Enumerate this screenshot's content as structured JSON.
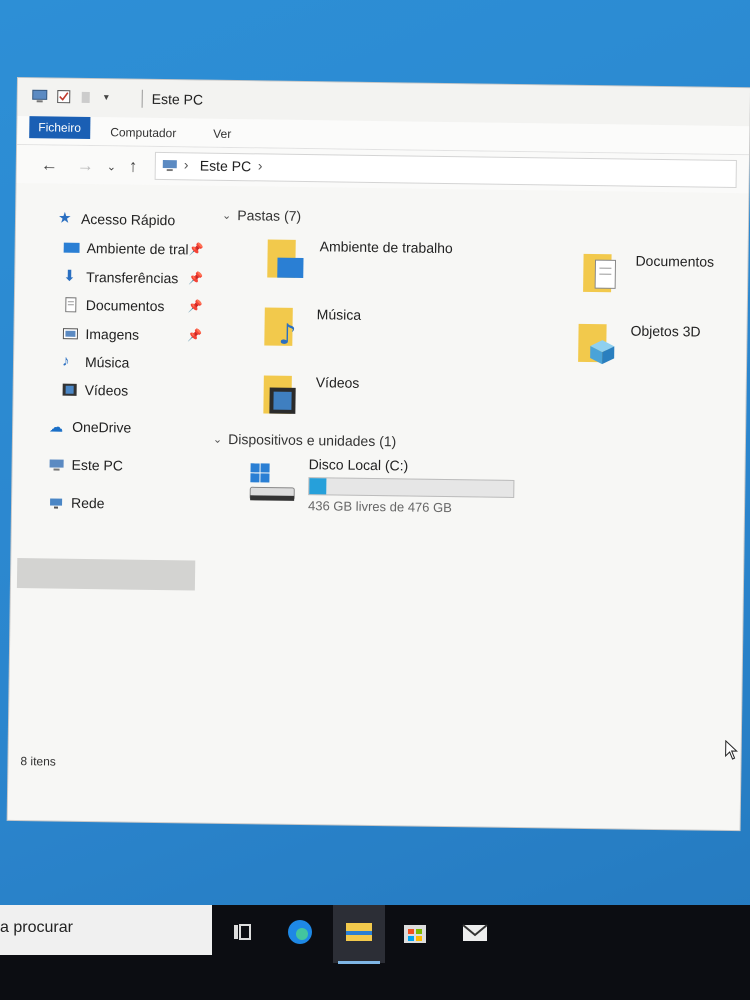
{
  "window": {
    "title": "Este PC",
    "ribbon_tabs": [
      "Ficheiro",
      "Computador",
      "Ver"
    ],
    "address": {
      "crumb": "Este PC"
    },
    "status": "8 itens"
  },
  "navigation": {
    "quick_access": "Acesso Rápido",
    "quick_items": [
      {
        "label": "Ambiente de tral",
        "icon": "desktop-icon",
        "pinned": true
      },
      {
        "label": "Transferências",
        "icon": "download-icon",
        "pinned": true
      },
      {
        "label": "Documentos",
        "icon": "document-icon",
        "pinned": true
      },
      {
        "label": "Imagens",
        "icon": "image-icon",
        "pinned": true
      },
      {
        "label": "Música",
        "icon": "music-icon",
        "pinned": false
      },
      {
        "label": "Vídeos",
        "icon": "video-icon",
        "pinned": false
      }
    ],
    "onedrive": "OneDrive",
    "this_pc": "Este PC",
    "network": "Rede"
  },
  "content": {
    "folders_header": "Pastas (7)",
    "folders": [
      {
        "label": "Ambiente de trabalho",
        "icon": "desktop-folder-icon"
      },
      {
        "label": "Documentos",
        "icon": "documents-folder-icon"
      },
      {
        "label": "Música",
        "icon": "music-folder-icon"
      },
      {
        "label": "Objetos 3D",
        "icon": "3d-objects-folder-icon"
      },
      {
        "label": "Vídeos",
        "icon": "videos-folder-icon"
      }
    ],
    "devices_header": "Dispositivos e unidades (1)",
    "drive": {
      "name": "Disco Local (C:)",
      "free_text": "436 GB livres de 476 GB",
      "used_fraction": 0.084
    }
  },
  "taskbar": {
    "search_text": "a procurar",
    "apps": [
      "task-view-icon",
      "edge-icon",
      "file-explorer-icon",
      "store-icon",
      "mail-icon"
    ]
  },
  "colors": {
    "accent": "#1a5fb4",
    "drive_fill": "#26a0da",
    "folder": "#f2c94c",
    "desktop_bg": "#2b85cd"
  }
}
